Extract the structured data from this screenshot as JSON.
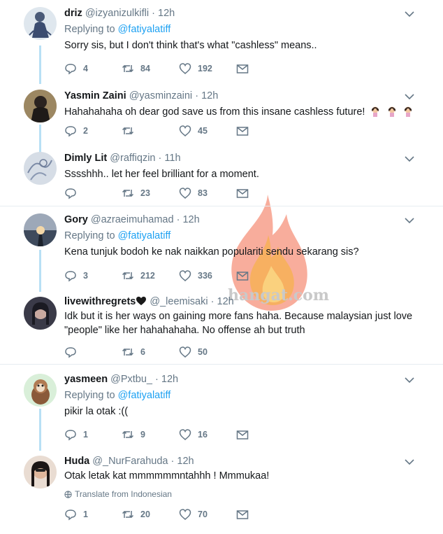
{
  "tweets": [
    {
      "name": "driz",
      "handle": "@izyanizulkifli",
      "time": "12h",
      "replying_label": "Replying to",
      "replying_to": "@fatiyalatiff",
      "text": "Sorry sis, but I don't think that's what \"cashless\" means..",
      "replies": "4",
      "retweets": "84",
      "likes": "192"
    },
    {
      "name": "Yasmin Zaini",
      "handle": "@yasminzaini",
      "time": "12h",
      "text": "Hahahahaha oh dear god save us from this insane cashless future!",
      "replies": "2",
      "retweets": "",
      "likes": "45"
    },
    {
      "name": "Dimly Lit",
      "handle": "@raffiqzin",
      "time": "11h",
      "text": "Sssshhh.. let her feel brilliant for a moment.",
      "replies": "",
      "retweets": "23",
      "likes": "83"
    },
    {
      "name": "Gory",
      "handle": "@azraeimuhamad",
      "time": "12h",
      "replying_label": "Replying to",
      "replying_to": "@fatiyalatiff",
      "text": "Kena tunjuk bodoh ke nak naikkan populariti sendu sekarang sis?",
      "replies": "3",
      "retweets": "212",
      "likes": "336"
    },
    {
      "name": "livewithregrets",
      "handle": "@_leemisaki",
      "time": "12h",
      "text": "Idk but it is her ways on gaining more fans haha. Because malaysian just love \"people\" like her hahahahaha. No offense ah but truth",
      "replies": "",
      "retweets": "6",
      "likes": "50"
    },
    {
      "name": "yasmeen",
      "handle": "@Pxtbu_",
      "time": "12h",
      "replying_label": "Replying to",
      "replying_to": "@fatiyalatiff",
      "text": "pikir la otak :((",
      "replies": "1",
      "retweets": "9",
      "likes": "16"
    },
    {
      "name": "Huda",
      "handle": "@_NurFarahuda",
      "time": "12h",
      "text": "Otak letak kat mmmmmmntahhh ! Mmmukaa!",
      "translate": "Translate from Indonesian",
      "replies": "1",
      "retweets": "20",
      "likes": "70"
    }
  ],
  "watermark": "hangat.com",
  "colors": {
    "accent": "#1da1f2",
    "muted": "#657786",
    "thread": "#b8e0f5",
    "divider": "#e6ecf0"
  }
}
